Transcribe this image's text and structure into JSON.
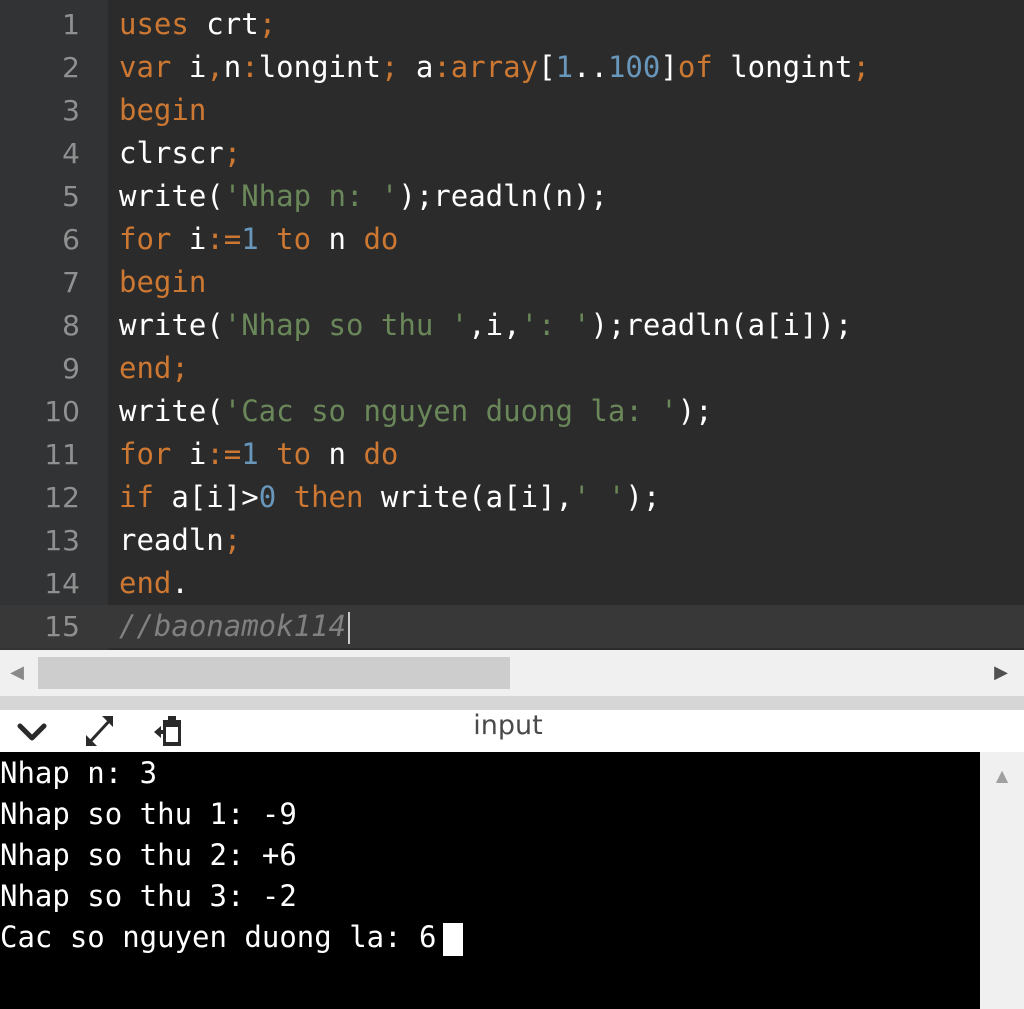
{
  "editor": {
    "lines": [
      {
        "num": "1",
        "tokens": [
          {
            "t": "uses",
            "c": "kw"
          },
          {
            "t": " crt",
            "c": "id"
          },
          {
            "t": ";",
            "c": "kw"
          }
        ]
      },
      {
        "num": "2",
        "tokens": [
          {
            "t": "var",
            "c": "kw"
          },
          {
            "t": " i",
            "c": "id"
          },
          {
            "t": ",",
            "c": "kw"
          },
          {
            "t": "n",
            "c": "id"
          },
          {
            "t": ":",
            "c": "kw"
          },
          {
            "t": "longint",
            "c": "id"
          },
          {
            "t": ";",
            "c": "kw"
          },
          {
            "t": " a",
            "c": "id"
          },
          {
            "t": ":",
            "c": "kw"
          },
          {
            "t": "array",
            "c": "kw"
          },
          {
            "t": "[",
            "c": "id"
          },
          {
            "t": "1",
            "c": "num"
          },
          {
            "t": "..",
            "c": "id"
          },
          {
            "t": "100",
            "c": "num"
          },
          {
            "t": "]",
            "c": "id"
          },
          {
            "t": "of",
            "c": "kw"
          },
          {
            "t": " longint",
            "c": "id"
          },
          {
            "t": ";",
            "c": "kw"
          }
        ]
      },
      {
        "num": "3",
        "tokens": [
          {
            "t": "begin",
            "c": "kw"
          }
        ]
      },
      {
        "num": "4",
        "tokens": [
          {
            "t": "clrscr",
            "c": "id"
          },
          {
            "t": ";",
            "c": "kw"
          }
        ]
      },
      {
        "num": "5",
        "tokens": [
          {
            "t": "write(",
            "c": "id"
          },
          {
            "t": "'Nhap n: '",
            "c": "str"
          },
          {
            "t": ");readln(n);",
            "c": "id"
          }
        ]
      },
      {
        "num": "6",
        "tokens": [
          {
            "t": "for",
            "c": "kw"
          },
          {
            "t": " i",
            "c": "id"
          },
          {
            "t": ":=",
            "c": "kw"
          },
          {
            "t": "1",
            "c": "num"
          },
          {
            "t": " to",
            "c": "kw"
          },
          {
            "t": " n",
            "c": "id"
          },
          {
            "t": " do",
            "c": "kw"
          }
        ]
      },
      {
        "num": "7",
        "tokens": [
          {
            "t": "begin",
            "c": "kw"
          }
        ]
      },
      {
        "num": "8",
        "tokens": [
          {
            "t": "write(",
            "c": "id"
          },
          {
            "t": "'Nhap so thu '",
            "c": "str"
          },
          {
            "t": ",i,",
            "c": "id"
          },
          {
            "t": "': '",
            "c": "str"
          },
          {
            "t": ");readln(a[i]);",
            "c": "id"
          }
        ]
      },
      {
        "num": "9",
        "tokens": [
          {
            "t": "end;",
            "c": "kw"
          }
        ]
      },
      {
        "num": "10",
        "tokens": [
          {
            "t": "write(",
            "c": "id"
          },
          {
            "t": "'Cac so nguyen duong la: '",
            "c": "str"
          },
          {
            "t": ");",
            "c": "id"
          }
        ]
      },
      {
        "num": "11",
        "tokens": [
          {
            "t": "for",
            "c": "kw"
          },
          {
            "t": " i",
            "c": "id"
          },
          {
            "t": ":=",
            "c": "kw"
          },
          {
            "t": "1",
            "c": "num"
          },
          {
            "t": " to",
            "c": "kw"
          },
          {
            "t": " n",
            "c": "id"
          },
          {
            "t": " do",
            "c": "kw"
          }
        ]
      },
      {
        "num": "12",
        "tokens": [
          {
            "t": "if",
            "c": "kw"
          },
          {
            "t": " a[i]>",
            "c": "id"
          },
          {
            "t": "0",
            "c": "num"
          },
          {
            "t": " then",
            "c": "kw"
          },
          {
            "t": " write(a[i],",
            "c": "id"
          },
          {
            "t": "' '",
            "c": "str"
          },
          {
            "t": ");",
            "c": "id"
          }
        ]
      },
      {
        "num": "13",
        "tokens": [
          {
            "t": "readln",
            "c": "id"
          },
          {
            "t": ";",
            "c": "kw"
          }
        ]
      },
      {
        "num": "14",
        "tokens": [
          {
            "t": "end",
            "c": "kw"
          },
          {
            "t": ".",
            "c": "id"
          }
        ]
      },
      {
        "num": "15",
        "tokens": [
          {
            "t": "//baonamok114",
            "c": "cmt"
          }
        ]
      }
    ]
  },
  "panel": {
    "title": "input",
    "collapse_icon": "chevron-down-icon",
    "expand_icon": "expand-arrows-icon",
    "paste_icon": "clipboard-icon"
  },
  "console": {
    "lines": [
      "Nhap n: 3",
      "Nhap so thu 1: -9",
      "Nhap so thu 2: +6",
      "Nhap so thu 3: -2",
      "Cac so nguyen duong la: 6"
    ]
  },
  "colors": {
    "keyword": "#cc7832",
    "string": "#6a8759",
    "number": "#6897bb",
    "comment": "#808080",
    "editor_bg": "#2b2b2b",
    "console_bg": "#000000"
  }
}
